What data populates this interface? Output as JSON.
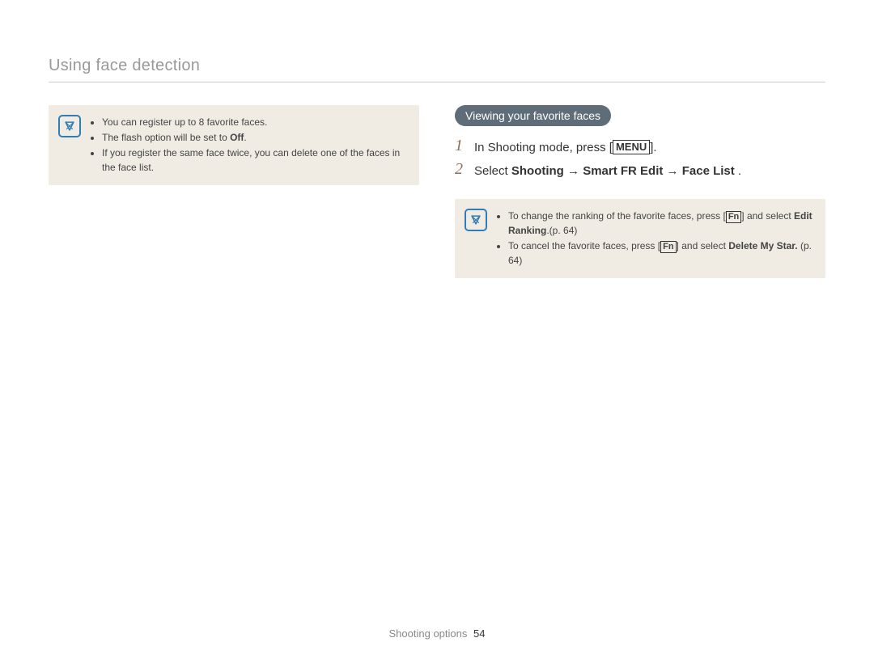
{
  "header": {
    "title": "Using face detection"
  },
  "left_note": {
    "items": [
      {
        "text": "You can register up to 8 favorite faces."
      },
      {
        "before": "The flash option will be set to ",
        "bold": "Off",
        "after": "."
      },
      {
        "text": "If you register the same face twice, you can delete one of the faces in the face list."
      }
    ]
  },
  "right": {
    "section_badge": "Viewing your favorite faces",
    "step1": {
      "num": "1",
      "prefix": "In Shooting mode, press [",
      "button": "MENU",
      "suffix": "]."
    },
    "step2": {
      "num": "2",
      "prefix": "Select ",
      "bold1": "Shooting",
      "arrow1": " → ",
      "bold2": "Smart FR Edit",
      "arrow2": " → ",
      "bold3": "Face List",
      "suffix": " ."
    },
    "note": {
      "items": [
        {
          "before": "To change the ranking of the favorite faces, press [",
          "fn": "Fn",
          "mid": "] and select ",
          "bold": "Edit Ranking",
          "after": ".(p. 64)"
        },
        {
          "before": "To cancel the favorite faces, press [",
          "fn": "Fn",
          "mid": "] and select ",
          "bold": "Delete My Star.",
          "after": " (p. 64)"
        }
      ]
    }
  },
  "footer": {
    "section": "Shooting options",
    "page": "54"
  }
}
